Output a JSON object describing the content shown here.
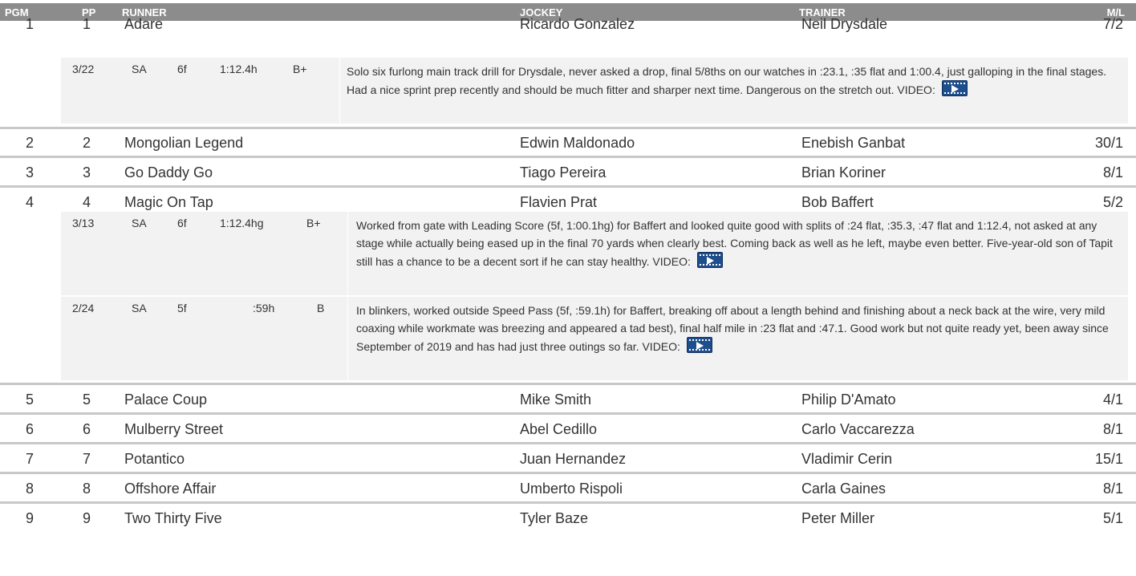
{
  "columns": {
    "pgm": "PGM",
    "pp": "PP",
    "runner": "RUNNER",
    "jockey": "JOCKEY",
    "trainer": "TRAINER",
    "ml": "M/L"
  },
  "runners": [
    {
      "pgm": "1",
      "pp": "1",
      "name": "Adare",
      "jockey": "Ricardo Gonzalez",
      "trainer": "Neil Drysdale",
      "ml": "7/2",
      "works": [
        {
          "date": "3/22",
          "track": "SA",
          "dist": "6f",
          "time": "1:12.4h",
          "grade": "B+",
          "comment": "Solo six furlong main track drill for Drysdale, never asked a drop, final 5/8ths on our watches in :23.1, :35 flat and 1:00.4, just galloping in the final stages. Had a nice sprint prep recently and should be much fitter and sharper next time. Dangerous on the stretch out. VIDEO:"
        }
      ]
    },
    {
      "pgm": "2",
      "pp": "2",
      "name": "Mongolian Legend",
      "jockey": "Edwin Maldonado",
      "trainer": "Enebish Ganbat",
      "ml": "30/1"
    },
    {
      "pgm": "3",
      "pp": "3",
      "name": "Go Daddy Go",
      "jockey": "Tiago Pereira",
      "trainer": "Brian Koriner",
      "ml": "8/1"
    },
    {
      "pgm": "4",
      "pp": "4",
      "name": "Magic On Tap",
      "jockey": "Flavien Prat",
      "trainer": "Bob Baffert",
      "ml": "5/2",
      "works": [
        {
          "date": "3/13",
          "track": "SA",
          "dist": "6f",
          "time": "1:12.4hg",
          "grade": "B+",
          "comment": "Worked from gate with Leading Score (5f, 1:00.1hg) for Baffert and looked quite good with splits of :24 flat, :35.3, :47 flat and 1:12.4, not asked at any stage while actually being eased up in the final 70 yards when clearly best. Coming back as well as he left, maybe even better. Five-year-old son of Tapit still has a chance to be a decent sort if he can stay healthy. VIDEO:"
        },
        {
          "date": "2/24",
          "track": "SA",
          "dist": "5f",
          "time": ":59h",
          "grade": "B",
          "comment": "In blinkers, worked outside Speed Pass (5f, :59.1h) for Baffert, breaking off about a length behind and finishing about a neck back at the wire, very mild coaxing while workmate was breezing and appeared a tad best), final half mile in :23 flat and :47.1. Good work but not quite ready yet, been away since September of 2019 and has had just three outings so far. VIDEO:"
        }
      ]
    },
    {
      "pgm": "5",
      "pp": "5",
      "name": "Palace Coup",
      "jockey": "Mike Smith",
      "trainer": "Philip D'Amato",
      "ml": "4/1"
    },
    {
      "pgm": "6",
      "pp": "6",
      "name": "Mulberry Street",
      "jockey": "Abel Cedillo",
      "trainer": "Carlo Vaccarezza",
      "ml": "8/1"
    },
    {
      "pgm": "7",
      "pp": "7",
      "name": "Potantico",
      "jockey": "Juan Hernandez",
      "trainer": "Vladimir Cerin",
      "ml": "15/1"
    },
    {
      "pgm": "8",
      "pp": "8",
      "name": "Offshore Affair",
      "jockey": "Umberto Rispoli",
      "trainer": "Carla Gaines",
      "ml": "8/1"
    },
    {
      "pgm": "9",
      "pp": "9",
      "name": "Two Thirty Five",
      "jockey": "Tyler Baze",
      "trainer": "Peter Miller",
      "ml": "5/1"
    }
  ]
}
